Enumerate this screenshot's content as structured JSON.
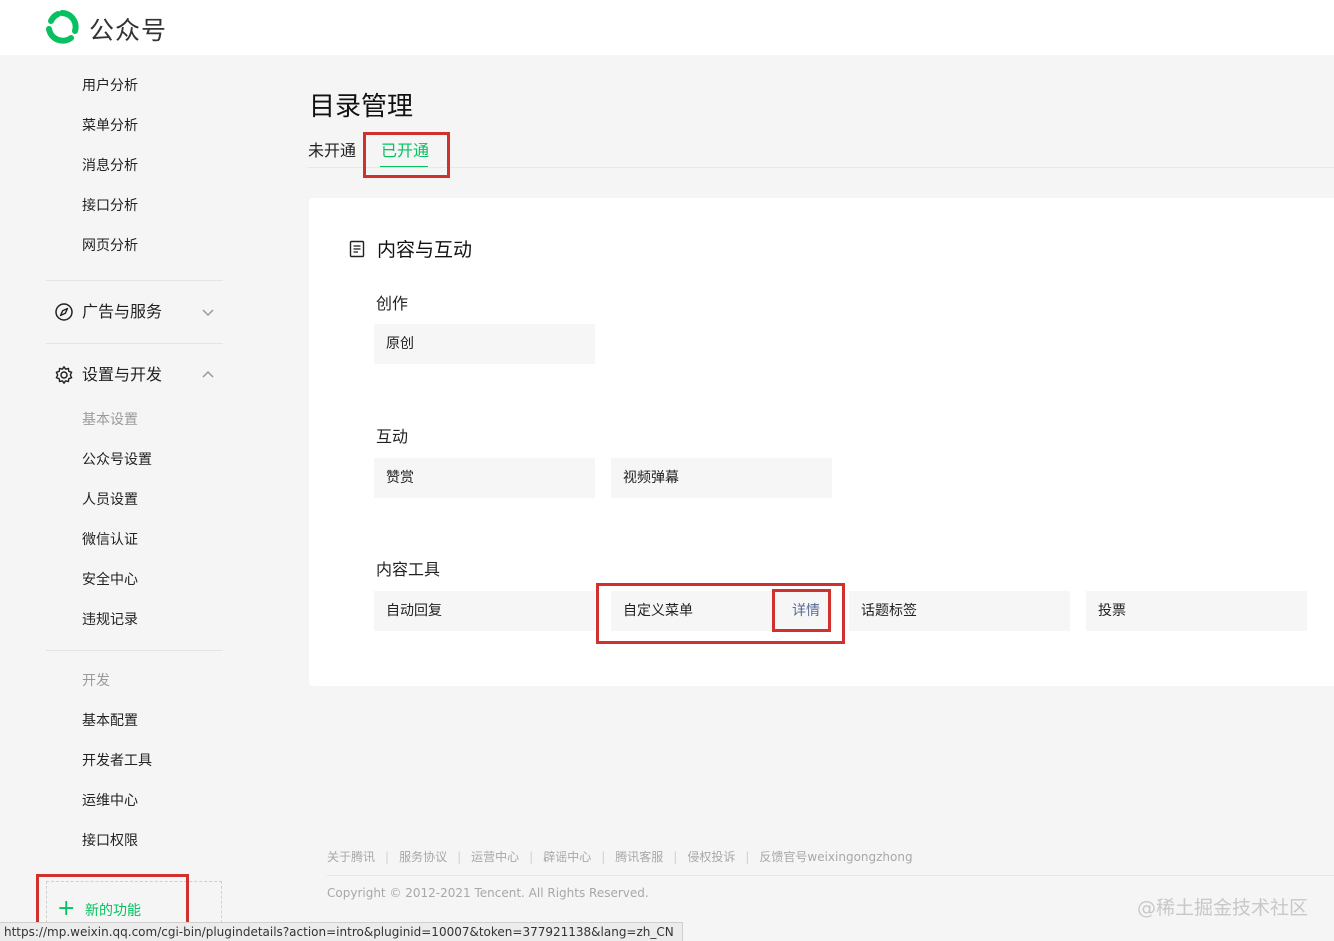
{
  "brand": {
    "name": "公众号",
    "accent": "#07c160"
  },
  "sidebar": {
    "analysis_items": [
      "用户分析",
      "菜单分析",
      "消息分析",
      "接口分析",
      "网页分析"
    ],
    "groups": [
      {
        "label": "广告与服务",
        "icon": "compass-icon",
        "expanded": false
      },
      {
        "label": "设置与开发",
        "icon": "gear-icon",
        "expanded": true
      }
    ],
    "settings_heading": "基本设置",
    "settings_items": [
      "公众号设置",
      "人员设置",
      "微信认证",
      "安全中心",
      "违规记录"
    ],
    "dev_heading": "开发",
    "dev_items": [
      "基本配置",
      "开发者工具",
      "运维中心",
      "接口权限"
    ],
    "new_feature": {
      "plus": "+",
      "label": "新的功能"
    }
  },
  "main": {
    "title": "目录管理",
    "tabs": [
      {
        "label": "未开通",
        "active": false
      },
      {
        "label": "已开通",
        "active": true
      }
    ],
    "card": {
      "title": "内容与互动",
      "icon": "document-icon",
      "sections": [
        {
          "title": "创作",
          "items": [
            {
              "label": "原创"
            }
          ]
        },
        {
          "title": "互动",
          "items": [
            {
              "label": "赞赏"
            },
            {
              "label": "视频弹幕"
            }
          ]
        },
        {
          "title": "内容工具",
          "items": [
            {
              "label": "自动回复"
            },
            {
              "label": "自定义菜单",
              "detail": "详情"
            },
            {
              "label": "话题标签"
            },
            {
              "label": "投票"
            }
          ]
        }
      ]
    }
  },
  "footer": {
    "links": [
      "关于腾讯",
      "服务协议",
      "运营中心",
      "辟谣中心",
      "腾讯客服",
      "侵权投诉",
      "反馈官号weixingongzhong"
    ],
    "separator": "|",
    "copyright": "Copyright © 2012-2021 Tencent. All Rights Reserved."
  },
  "watermark": "@稀土掘金技术社区",
  "status_url": "https://mp.weixin.qq.com/cgi-bin/plugindetails?action=intro&pluginid=10007&token=377921138&lang=zh_CN",
  "highlight_color": "#d0312d"
}
